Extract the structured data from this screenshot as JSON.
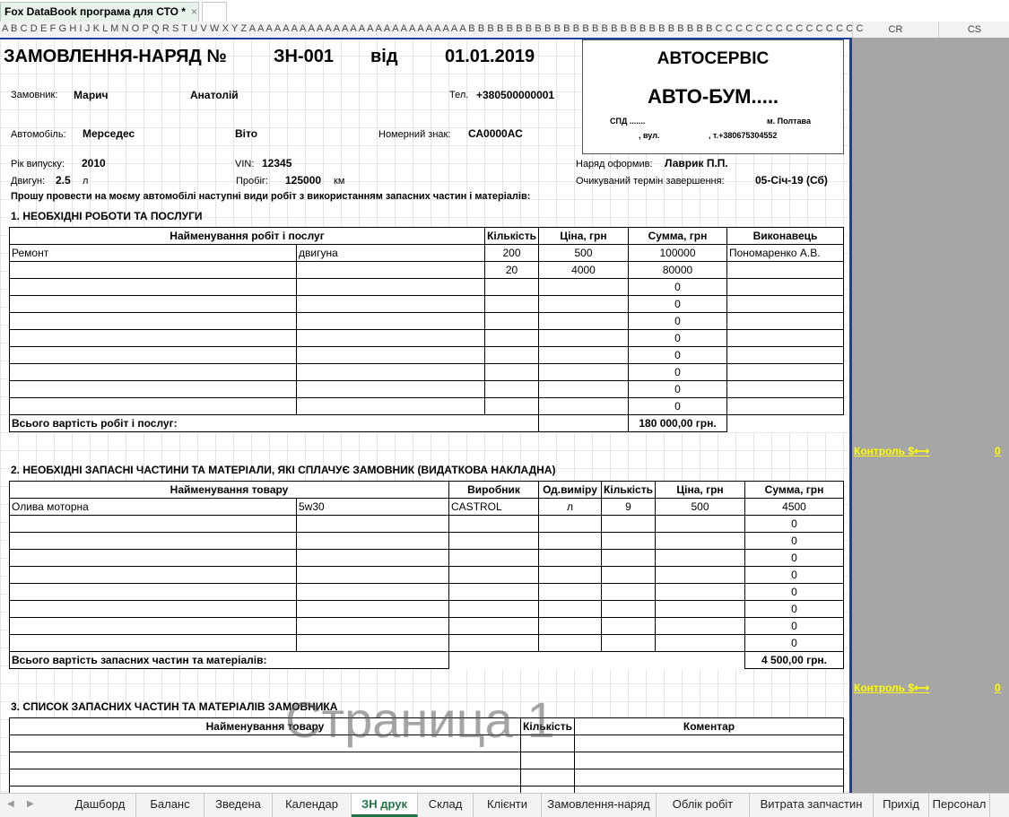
{
  "app": {
    "file_tab": "Fox DataBook програма для СТО *",
    "close_glyph": "×"
  },
  "columns": {
    "letters": "A B C D E F G H I J K L M N O P Q R S T U V W X Y Z A A A A A A A A A A A A A A A A A A A A A A A A A A B B B B B B B B B B B B B B B B B B B B B B B B B B C C C C C C C C C C C C C C C",
    "cr": "CR",
    "cs": "CS"
  },
  "header": {
    "title": "ЗАМОВЛЕННЯ-НАРЯД №",
    "number": "ЗН-001",
    "from_label": "від",
    "date": "01.01.2019",
    "customer_label": "Замовник:",
    "customer_lastname": "Марич",
    "customer_firstname": "Анатолій",
    "phone_label": "Тел.",
    "phone": "+380500000001",
    "car_label": "Автомобіль:",
    "car_make": "Мерседес",
    "car_model": "Віто",
    "plate_label": "Номерний знак:",
    "plate": "СА0000АС",
    "year_label": "Рік випуску:",
    "year": "2010",
    "vin_label": "VIN:",
    "vin": "12345",
    "engine_label": "Двигун:",
    "engine": "2.5",
    "engine_unit": "л",
    "mileage_label": "Пробіг:",
    "mileage": "125000",
    "mileage_unit": "км",
    "issued_label": "Наряд оформив:",
    "issued_by": "Лаврик П.П.",
    "due_label": "Очикуваний термін завершення:",
    "due_date": "05-Січ-19 (Сб)",
    "request_text": "Прошу провести на моєму автомобілі наступні види робіт з використанням запасних частин і матеріалів:"
  },
  "service": {
    "label": "АВТОСЕРВІС",
    "name": "АВТО-БУМ.....",
    "spd": "СПД      .......",
    "city": "м. Полтава",
    "street": ", вул.",
    "phone": ", т.+380675304552"
  },
  "works": {
    "section_title": "1. НЕОБХІДНІ РОБОТИ ТА ПОСЛУГИ",
    "headers": [
      "Найменування робіт і послуг",
      "Кількість",
      "Ціна, грн",
      "Сумма, грн",
      "Виконавець"
    ],
    "rows": [
      [
        "Ремонт",
        "двигуна",
        "200",
        "500",
        "100000",
        "Пономаренко А.В."
      ],
      [
        "",
        "",
        "20",
        "4000",
        "80000",
        ""
      ],
      [
        "",
        "",
        "",
        "",
        "0",
        ""
      ],
      [
        "",
        "",
        "",
        "",
        "0",
        ""
      ],
      [
        "",
        "",
        "",
        "",
        "0",
        ""
      ],
      [
        "",
        "",
        "",
        "",
        "0",
        ""
      ],
      [
        "",
        "",
        "",
        "",
        "0",
        ""
      ],
      [
        "",
        "",
        "",
        "",
        "0",
        ""
      ],
      [
        "",
        "",
        "",
        "",
        "0",
        ""
      ],
      [
        "",
        "",
        "",
        "",
        "0",
        ""
      ]
    ],
    "total_label": "Всього вартість робіт і послуг:",
    "total": "180 000,00 грн."
  },
  "parts": {
    "section_title": "2. НЕОБХІДНІ ЗАПАСНІ ЧАСТИНИ ТА МАТЕРІАЛИ, ЯКІ СПЛАЧУЄ ЗАМОВНИК (ВИДАТКОВА НАКЛАДНА)",
    "headers": [
      "Найменування товару",
      "Виробник",
      "Од.виміру",
      "Кількість",
      "Ціна, грн",
      "Сумма, грн"
    ],
    "rows": [
      [
        "Олива моторна",
        "5w30",
        "CASTROL",
        "л",
        "9",
        "500",
        "4500"
      ],
      [
        "",
        "",
        "",
        "",
        "",
        "",
        "0"
      ],
      [
        "",
        "",
        "",
        "",
        "",
        "",
        "0"
      ],
      [
        "",
        "",
        "",
        "",
        "",
        "",
        "0"
      ],
      [
        "",
        "",
        "",
        "",
        "",
        "",
        "0"
      ],
      [
        "",
        "",
        "",
        "",
        "",
        "",
        "0"
      ],
      [
        "",
        "",
        "",
        "",
        "",
        "",
        "0"
      ],
      [
        "",
        "",
        "",
        "",
        "",
        "",
        "0"
      ],
      [
        "",
        "",
        "",
        "",
        "",
        "",
        "0"
      ]
    ],
    "total_label": "Всього вартість запасних частин та матеріалів:",
    "total": "4 500,00 грн."
  },
  "customer_parts": {
    "section_title": "3. СПИСОК ЗАПАСНИХ ЧАСТИН ТА МАТЕРІАЛІВ ЗАМОВНИКА",
    "headers": [
      "Найменування товару",
      "Кількість",
      "Коментар"
    ]
  },
  "controls": [
    {
      "label": "Контроль $⟷",
      "value": "0"
    },
    {
      "label": "Контроль $⟷",
      "value": "0"
    }
  ],
  "watermark": "Страница 1",
  "sheet_tabs": [
    "Дашборд",
    "Баланс",
    "Зведена",
    "Календар",
    "ЗН друк",
    "Склад",
    "Клієнти",
    "Замовлення-наряд",
    "Облік робіт",
    "Витрата запчастин",
    "Прихід",
    "Персонал"
  ],
  "active_tab": "ЗН друк",
  "colors": {
    "accent": "#217346",
    "page_border": "#1f3fa0",
    "control_link": "#ffff00",
    "outside_area": "#a6a6a6"
  }
}
